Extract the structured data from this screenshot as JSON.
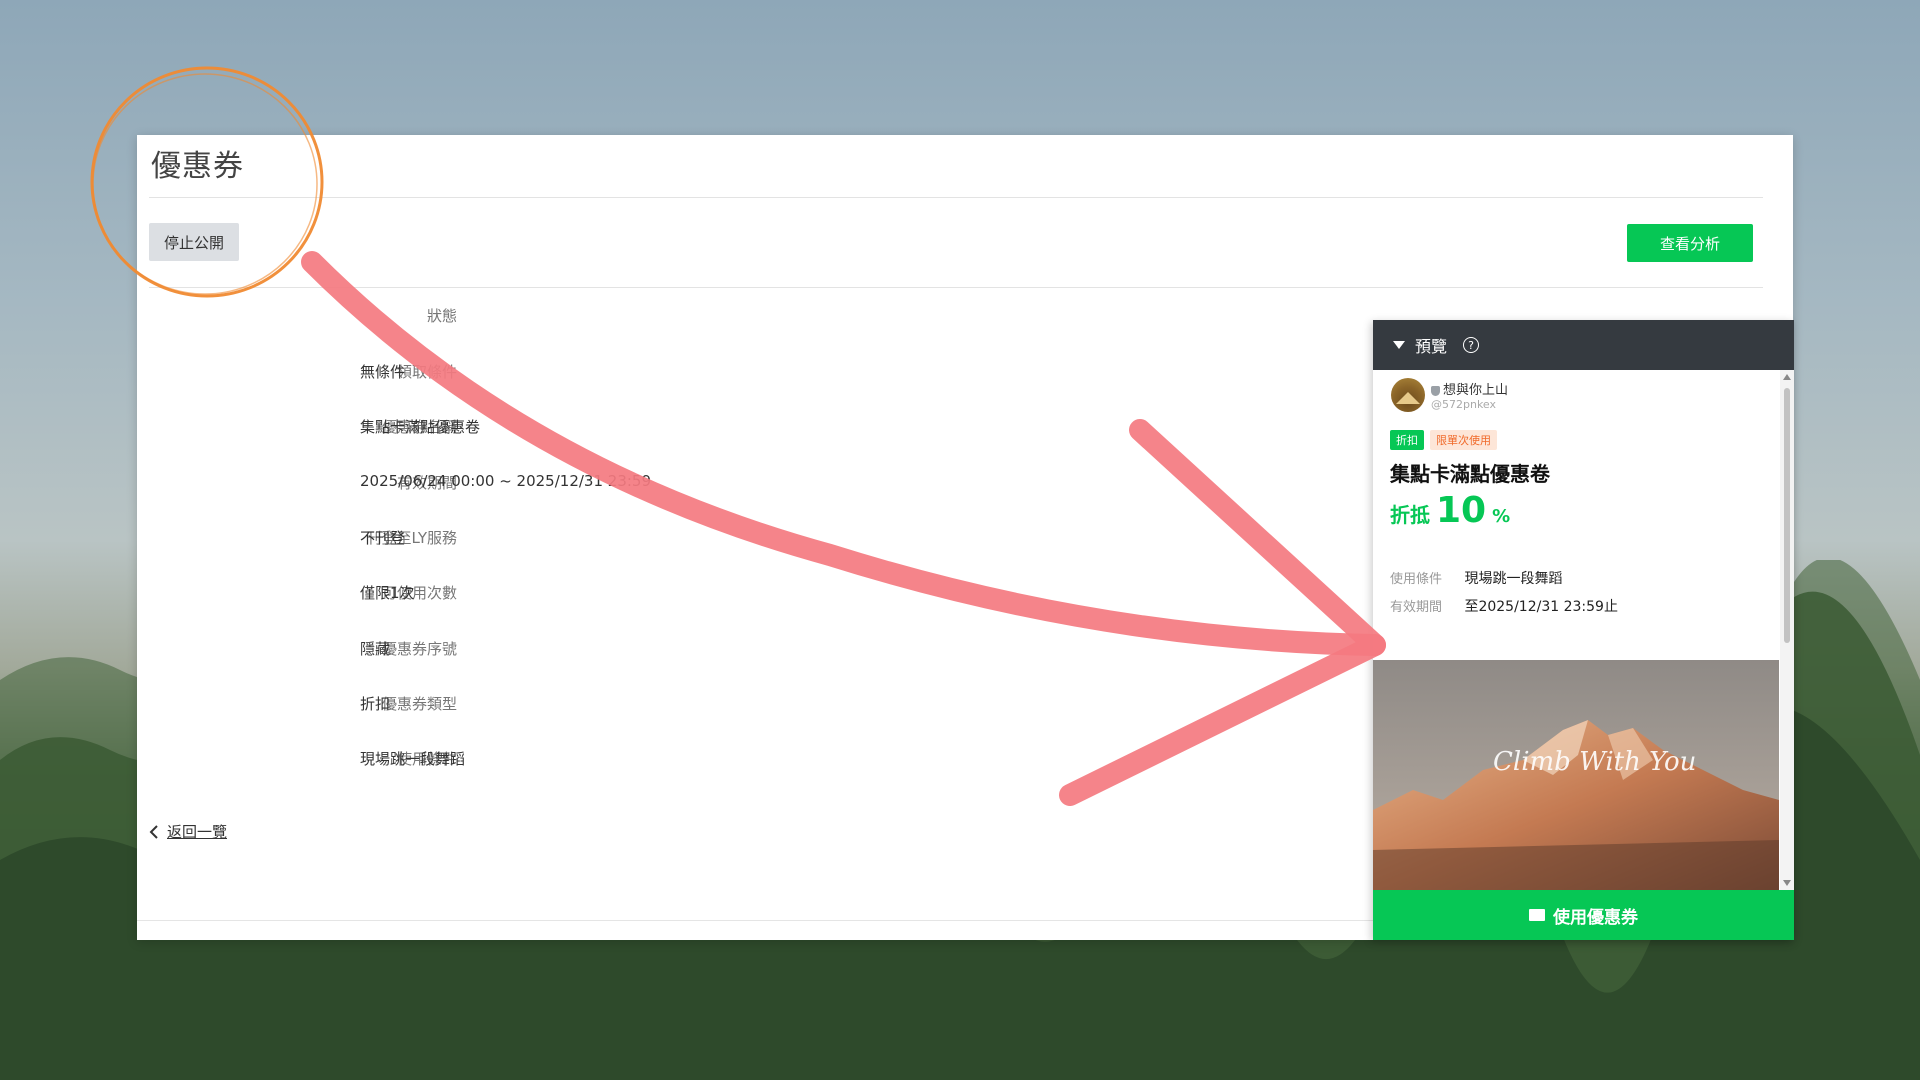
{
  "page": {
    "title": "優惠券",
    "stop_publish_label": "停止公開",
    "analysis_label": "查看分析",
    "back_label": "返回一覽"
  },
  "details": [
    {
      "label": "狀態",
      "value": ""
    },
    {
      "label": "領取條件",
      "value": "無條件"
    },
    {
      "label": "優惠券名稱",
      "value": "集點卡滿點優惠卷"
    },
    {
      "label": "有效期間",
      "value": "2025/06/24 00:00 ~ 2025/12/31 23:59"
    },
    {
      "label": "刊登至LY服務",
      "value": "不刊登"
    },
    {
      "label": "可使用次數",
      "value": "僅限1次"
    },
    {
      "label": "優惠券序號",
      "value": "隱藏"
    },
    {
      "label": "優惠券類型",
      "value": "折扣"
    },
    {
      "label": "使用條件",
      "value": "現場跳一段舞蹈"
    }
  ],
  "preview": {
    "header": "預覽",
    "account_name": "想與你上山",
    "account_id": "@572pnkex",
    "tag_type": "折扣",
    "tag_limit": "限單次使用",
    "coupon_title": "集點卡滿點優惠卷",
    "discount_prefix": "折抵",
    "discount_value": "10",
    "discount_unit": "%",
    "condition_label": "使用條件",
    "condition_value": "現場跳一段舞蹈",
    "period_label": "有效期間",
    "period_value": "至2025/12/31 23:59止",
    "image_script_text": "Climb With You",
    "use_button_label": "使用優惠券"
  },
  "colors": {
    "accent_green": "#06c755",
    "annotation_circle": "#f08a32",
    "annotation_arrow": "#f47a80",
    "header_dark": "#353a40"
  }
}
